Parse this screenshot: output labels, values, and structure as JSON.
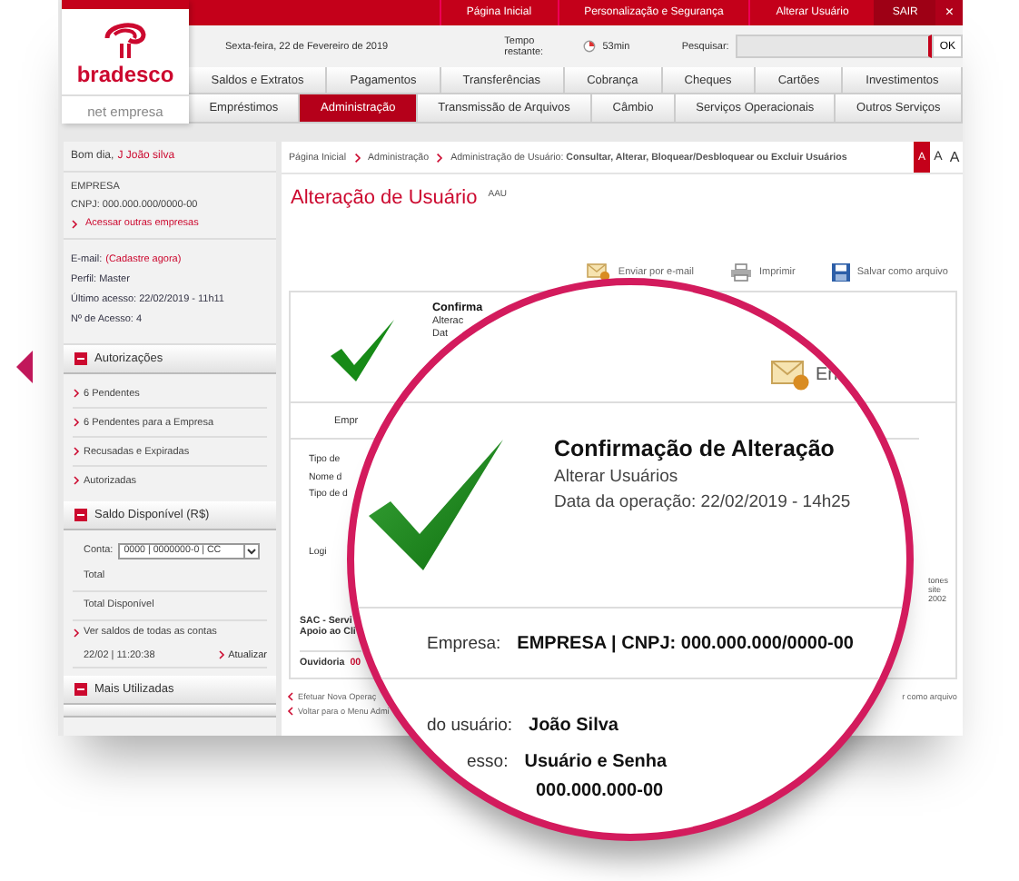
{
  "top_links": [
    {
      "label": "Página Inicial"
    },
    {
      "label": "Personalização e Segurança"
    },
    {
      "label": "Alterar Usuário"
    }
  ],
  "logout": "SAIR",
  "close": "×",
  "logo": {
    "name": "bradesco",
    "product": "net empresa"
  },
  "date": "Sexta-feira, 22 de Fevereiro de 2019",
  "timer": {
    "label": "Tempo restante:",
    "value": "53min"
  },
  "search": {
    "label": "Pesquisar:",
    "button": "OK"
  },
  "nav_rows": [
    [
      {
        "label": "Saldos e Extratos",
        "selected": false
      },
      {
        "label": "Pagamentos",
        "selected": false
      },
      {
        "label": "Transferências",
        "selected": false
      },
      {
        "label": "Cobrança",
        "selected": false
      },
      {
        "label": "Cheques",
        "selected": false
      },
      {
        "label": "Cartões",
        "selected": false
      },
      {
        "label": "Investimentos",
        "selected": false
      }
    ],
    [
      {
        "label": "Empréstimos",
        "selected": false
      },
      {
        "label": "Administração",
        "selected": true
      },
      {
        "label": "Transmissão de Arquivos",
        "selected": false
      },
      {
        "label": "Câmbio",
        "selected": false
      },
      {
        "label": "Serviços Operacionais",
        "selected": false
      },
      {
        "label": "Outros Serviços",
        "selected": false
      }
    ]
  ],
  "sidebar": {
    "greeting": "Bom dia,",
    "user": "J João silva",
    "company": "EMPRESA",
    "cnpj": "CNPJ: 000.000.000/0000-00",
    "other_companies": "Acessar outras empresas",
    "email_label": "E-mail:",
    "email_action": "(Cadastre agora)",
    "profile": "Perfil: Master",
    "last_access": "Último acesso: 22/02/2019 - 11h11",
    "access_count": "Nº de Acesso: 4",
    "sections": [
      {
        "kind": "links",
        "title": "Autorizações",
        "items": [
          "6 Pendentes",
          "6 Pendentes para a Empresa",
          "Recusadas e Expiradas",
          "Autorizadas"
        ]
      },
      {
        "kind": "balance",
        "title": "Saldo Disponível (R$)",
        "account_label": "Conta:",
        "account": "0000 | 0000000-0 | CC",
        "rows": [
          "Total",
          "Total Disponível"
        ],
        "all_accounts": "Ver saldos de todas as contas",
        "timestamp": "22/02 | 11:20:38",
        "refresh": "Atualizar"
      },
      {
        "kind": "header",
        "title": "Mais Utilizadas"
      }
    ]
  },
  "main": {
    "breadcrumb": [
      "Página Inicial",
      "Administração",
      "Administração de Usuário: **Consultar, Alterar, Bloquear/Desbloquear ou Excluir Usuários**"
    ],
    "font_sizes": [
      {
        "label": "A",
        "selected": true
      },
      {
        "label": "A",
        "selected": false
      },
      {
        "label": "A",
        "selected": false
      }
    ],
    "title": "Alteração de Usuário",
    "code": "AAU",
    "actions": [
      {
        "kind": "email",
        "label": "Enviar por e-mail"
      },
      {
        "kind": "print",
        "label": "Imprimir"
      },
      {
        "kind": "save",
        "label": "Salvar como arquivo"
      }
    ],
    "card": {
      "heading": "Confirma",
      "lines": [
        "Alterac",
        "Dat"
      ],
      "company_fragment": "Empr",
      "fields": [
        "Tipo de",
        "Nome d",
        "Tipo de d",
        "Logi"
      ],
      "sac": [
        "SAC - Servi",
        "Apoio ao Cli"
      ],
      "ouvidoria": "Ouvidoria",
      "ouvidoria_number": "00",
      "right_fragments": [
        "tones",
        "site",
        "2002"
      ]
    },
    "links": [
      "Efetuar Nova Operaç",
      "Voltar para o Menu Admi"
    ],
    "bottom_right": "r como arquivo"
  },
  "magnifier": {
    "email_fragment": "En",
    "heading": "Confirmação de Alteração",
    "subtitle": "Alterar Usuários",
    "date": "Data da operação: 22/02/2019 - 14h25",
    "company_label": "Empresa:",
    "company_value": "EMPRESA | CNPJ: 000.000.000/0000-00",
    "fields": [
      {
        "label": "do usuário:",
        "value": "João Silva"
      },
      {
        "label": "esso:",
        "value": "Usuário e Senha"
      },
      {
        "value": "000.000.000-00"
      }
    ]
  }
}
